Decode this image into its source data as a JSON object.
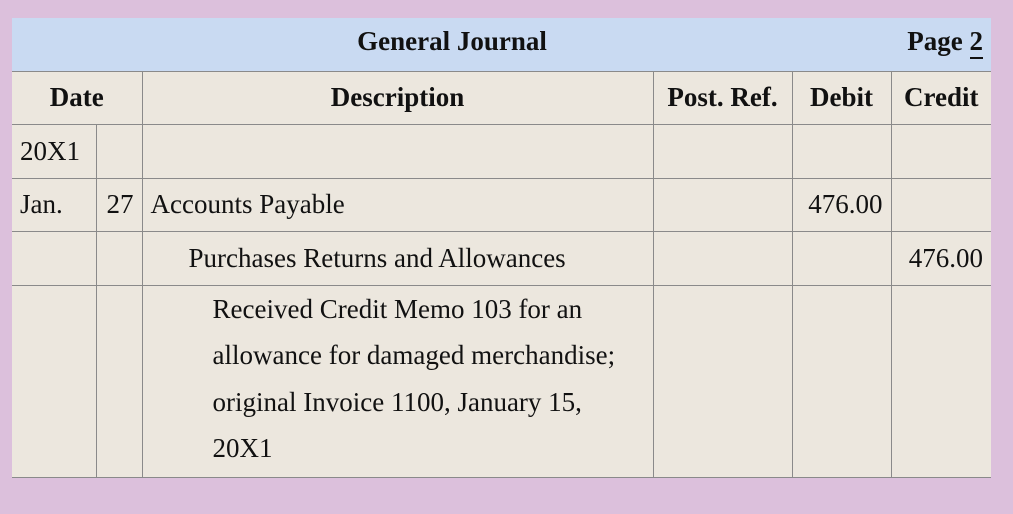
{
  "journal": {
    "title": "General Journal",
    "page_label": "Page",
    "page_number": "2"
  },
  "columns": {
    "date": "Date",
    "description": "Description",
    "post_ref": "Post. Ref.",
    "debit": "Debit",
    "credit": "Credit"
  },
  "entries": {
    "year": "20X1",
    "month": "Jan.",
    "day": "27",
    "debit_account": "Accounts Payable",
    "debit_amount": "476.00",
    "credit_account": "Purchases Returns and Allowances",
    "credit_amount": "476.00",
    "explanation": "Received Credit Memo 103 for an allowance for damaged merchandise; original Invoice 1100, January 15, 20X1"
  }
}
